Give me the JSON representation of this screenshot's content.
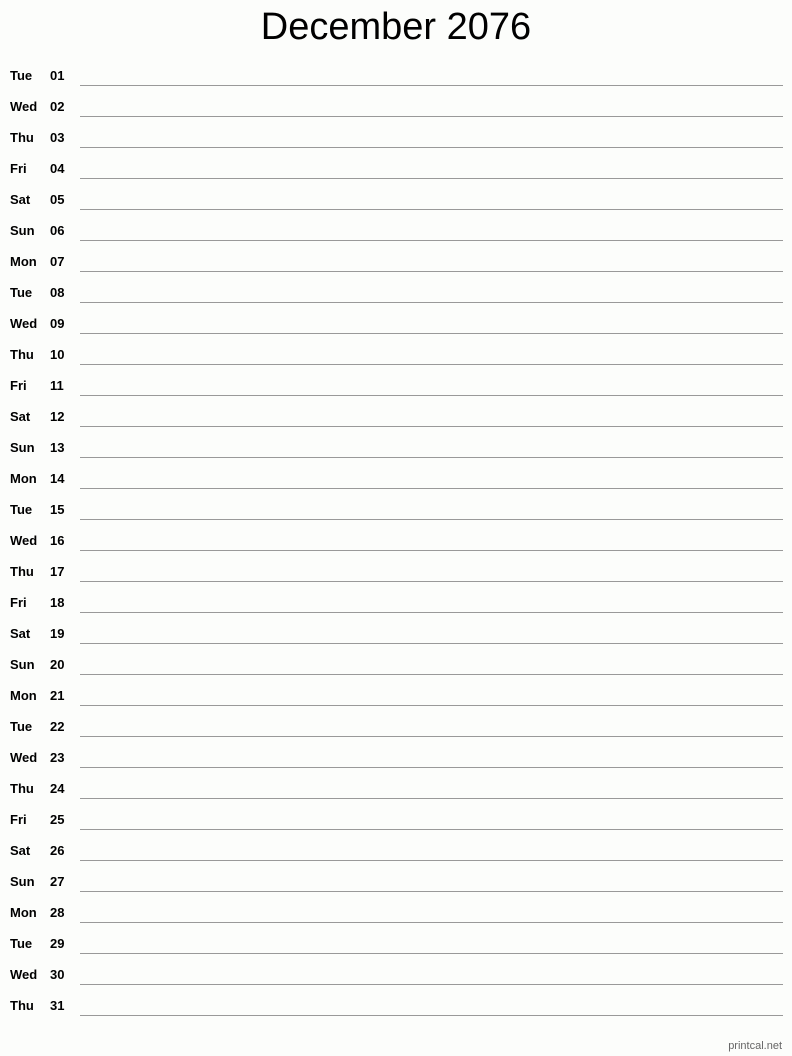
{
  "title": "December 2076",
  "days": [
    {
      "dow": "Tue",
      "day": "01"
    },
    {
      "dow": "Wed",
      "day": "02"
    },
    {
      "dow": "Thu",
      "day": "03"
    },
    {
      "dow": "Fri",
      "day": "04"
    },
    {
      "dow": "Sat",
      "day": "05"
    },
    {
      "dow": "Sun",
      "day": "06"
    },
    {
      "dow": "Mon",
      "day": "07"
    },
    {
      "dow": "Tue",
      "day": "08"
    },
    {
      "dow": "Wed",
      "day": "09"
    },
    {
      "dow": "Thu",
      "day": "10"
    },
    {
      "dow": "Fri",
      "day": "11"
    },
    {
      "dow": "Sat",
      "day": "12"
    },
    {
      "dow": "Sun",
      "day": "13"
    },
    {
      "dow": "Mon",
      "day": "14"
    },
    {
      "dow": "Tue",
      "day": "15"
    },
    {
      "dow": "Wed",
      "day": "16"
    },
    {
      "dow": "Thu",
      "day": "17"
    },
    {
      "dow": "Fri",
      "day": "18"
    },
    {
      "dow": "Sat",
      "day": "19"
    },
    {
      "dow": "Sun",
      "day": "20"
    },
    {
      "dow": "Mon",
      "day": "21"
    },
    {
      "dow": "Tue",
      "day": "22"
    },
    {
      "dow": "Wed",
      "day": "23"
    },
    {
      "dow": "Thu",
      "day": "24"
    },
    {
      "dow": "Fri",
      "day": "25"
    },
    {
      "dow": "Sat",
      "day": "26"
    },
    {
      "dow": "Sun",
      "day": "27"
    },
    {
      "dow": "Mon",
      "day": "28"
    },
    {
      "dow": "Tue",
      "day": "29"
    },
    {
      "dow": "Wed",
      "day": "30"
    },
    {
      "dow": "Thu",
      "day": "31"
    }
  ],
  "footer": "printcal.net"
}
